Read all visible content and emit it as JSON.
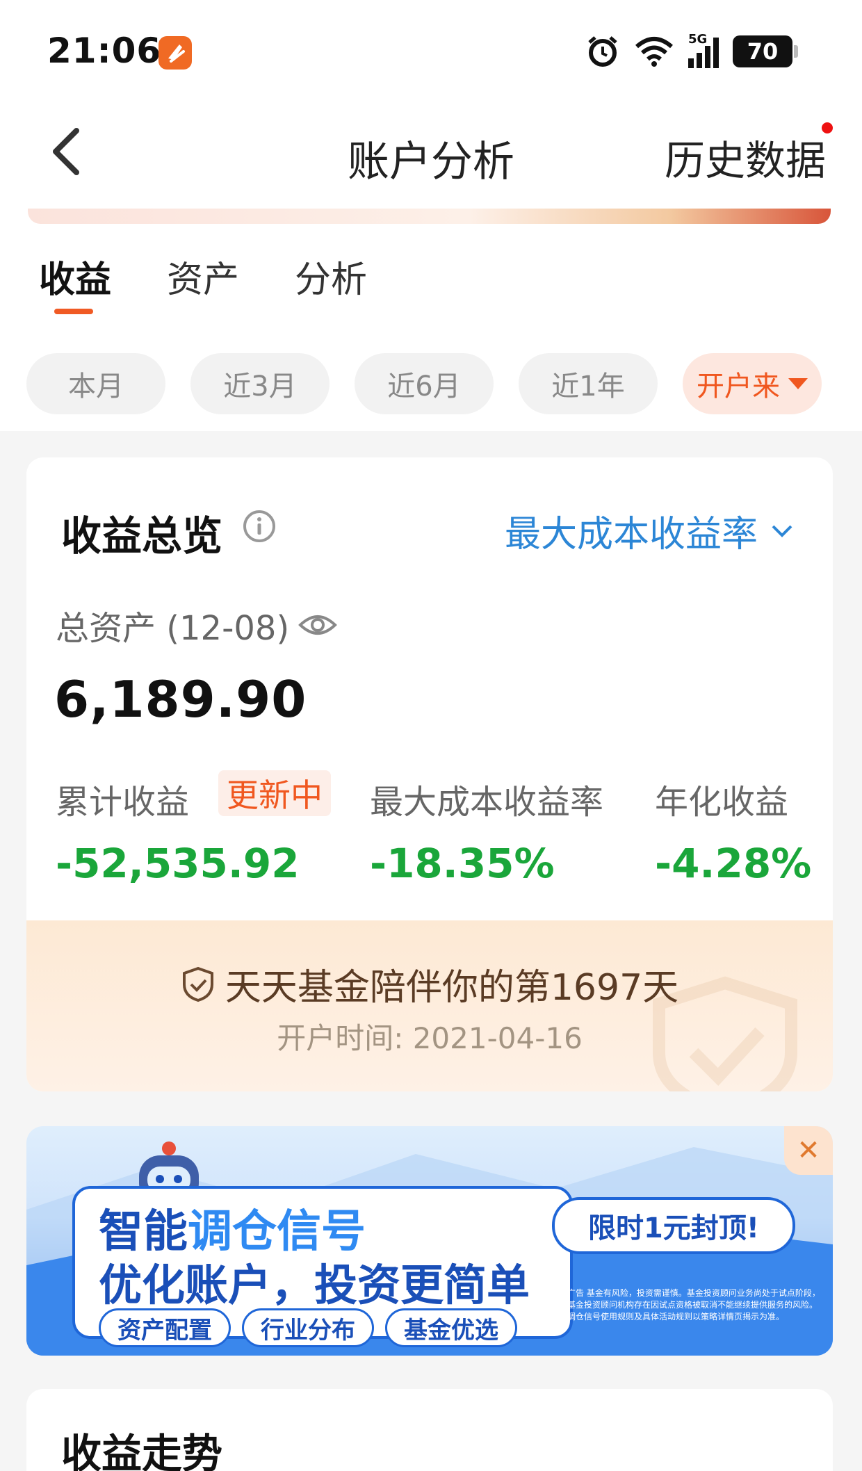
{
  "status_bar": {
    "time": "21:06",
    "network": "5G",
    "battery": "70"
  },
  "nav": {
    "title": "账户分析",
    "history_label": "历史数据"
  },
  "tabs": [
    {
      "label": "收益",
      "active": true
    },
    {
      "label": "资产",
      "active": false
    },
    {
      "label": "分析",
      "active": false
    }
  ],
  "filters": [
    {
      "label": "本月",
      "active": false
    },
    {
      "label": "近3月",
      "active": false
    },
    {
      "label": "近6月",
      "active": false
    },
    {
      "label": "近1年",
      "active": false
    },
    {
      "label": "开户来",
      "active": true
    }
  ],
  "summary": {
    "title": "收益总览",
    "rate_selector": "最大成本收益率",
    "asset_label": "总资产 (12-08)",
    "asset_value": "6,189.90",
    "metrics": [
      {
        "label": "累计收益",
        "value": "-52,535.92"
      },
      {
        "label": "最大成本收益率",
        "value": "-18.35%"
      },
      {
        "label": "年化收益",
        "value": "-4.28%"
      }
    ],
    "updating_badge": "更新中",
    "companion_text": "天天基金陪伴你的第1697天",
    "open_date": "开户时间: 2021-04-16",
    "value_color": "#1aa63a",
    "accent_color": "#f0571f",
    "link_color": "#2c86d6"
  },
  "ad": {
    "line1_prefix": "智能",
    "line1_highlight": "调仓信号",
    "line2": "优化账户，投资更简单",
    "pills": [
      "资产配置",
      "行业分布",
      "基金优选"
    ],
    "promo": "限时1元封顶!",
    "disclaimer": "广告 基金有风险，投资需谨慎。基金投资顾问业务尚处于试点阶段，基金投资顾问机构存在因试点资格被取消不能继续提供服务的风险。调仓信号使用规则及具体活动规则以策略详情页揭示为准。",
    "close_icon": "close-icon"
  },
  "trend": {
    "title": "收益走势"
  }
}
